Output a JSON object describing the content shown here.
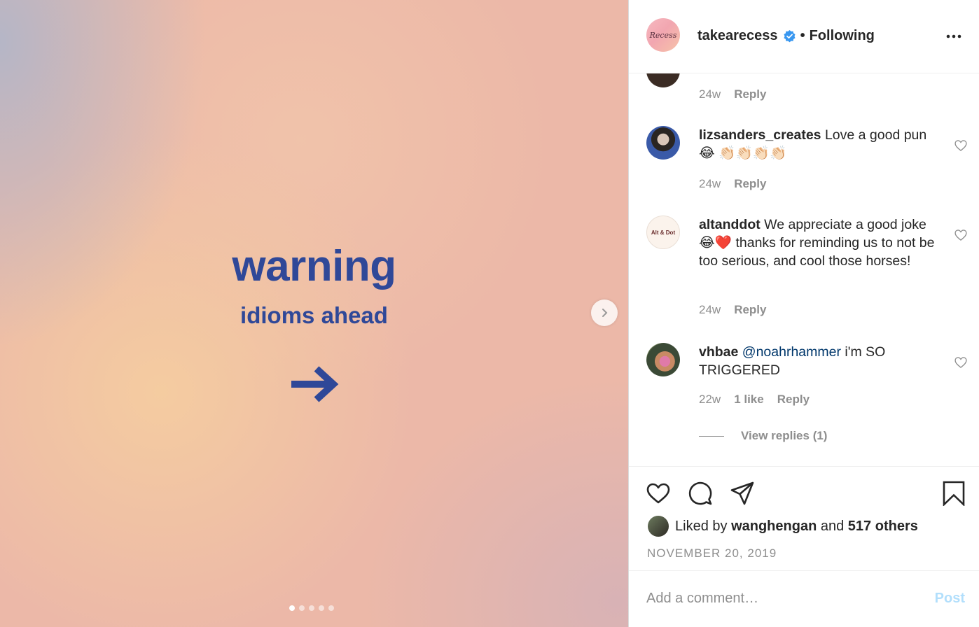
{
  "post": {
    "headline": "warning",
    "subline": "idioms ahead",
    "carousel": {
      "total_slides": 5,
      "active_index": 0
    }
  },
  "header": {
    "avatar_text": "Recess",
    "username": "takearecess",
    "separator": "•",
    "follow_status": "Following"
  },
  "comments": {
    "previous_meta": {
      "time": "24w",
      "reply": "Reply"
    },
    "items": [
      {
        "user": "lizsanders_creates",
        "text": "Love a good pun 😂 👏🏻👏🏻👏🏻👏🏻",
        "time": "24w",
        "reply": "Reply"
      },
      {
        "user": "altanddot",
        "avatar_text": "Alt & Dot",
        "text": "We appreciate a good joke 😂❤️ thanks for reminding us to not be too serious, and cool those horses!",
        "time": "24w",
        "reply": "Reply"
      },
      {
        "user": "vhbae",
        "mention": "@noahrhammer",
        "text": "i'm SO TRIGGERED",
        "time": "22w",
        "likes": "1 like",
        "reply": "Reply"
      }
    ],
    "view_replies": "View replies (1)"
  },
  "likes": {
    "prefix": "Liked by",
    "user": "wanghengan",
    "middle": "and",
    "others": "517 others"
  },
  "date": "NOVEMBER 20, 2019",
  "add_comment": {
    "placeholder": "Add a comment…",
    "post_label": "Post"
  },
  "colors": {
    "headline": "#2f4898",
    "verified": "#3897f0",
    "post_disabled": "#b2dffc",
    "mention": "#00376b"
  }
}
